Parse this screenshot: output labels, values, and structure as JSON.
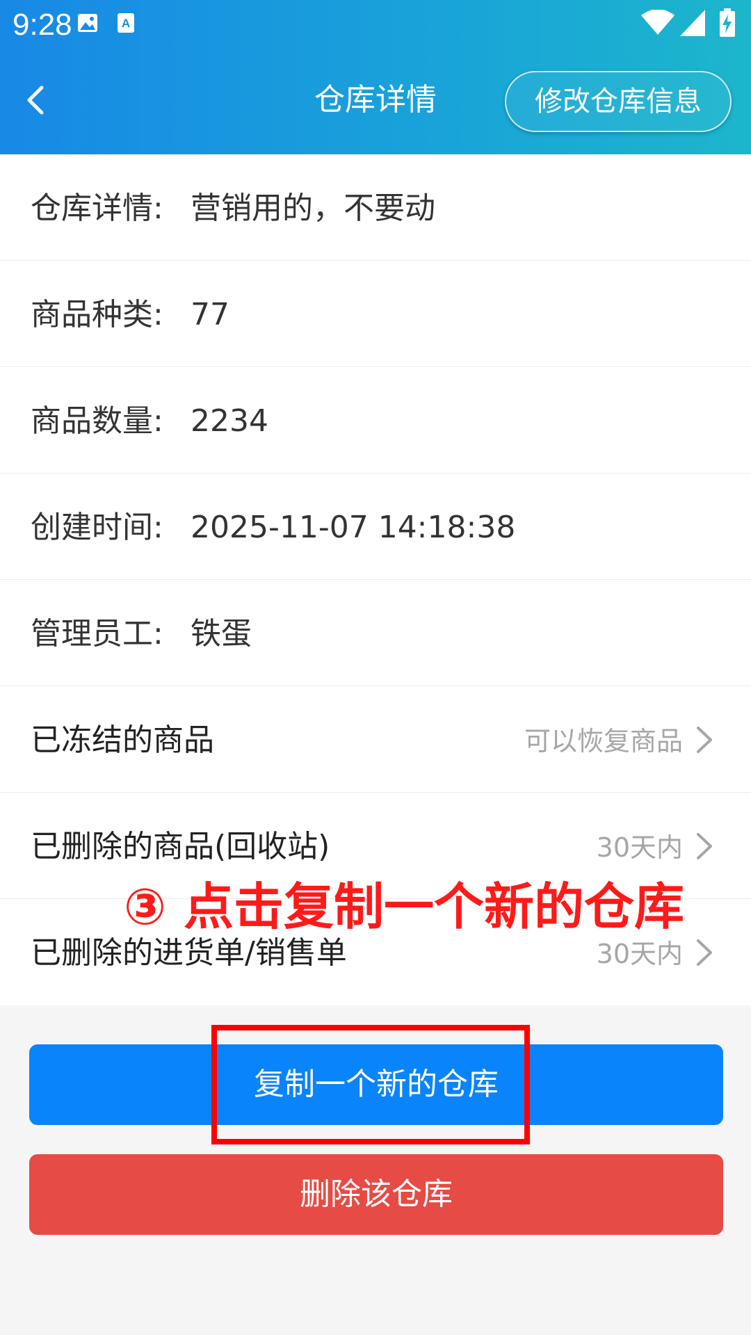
{
  "status_bar": {
    "time": "9:28"
  },
  "header": {
    "title": "仓库详情",
    "edit_button": "修改仓库信息"
  },
  "details": [
    {
      "label": "仓库详情:",
      "value": "营销用的，不要动"
    },
    {
      "label": "商品种类:",
      "value": "77"
    },
    {
      "label": "商品数量:",
      "value": "2234"
    },
    {
      "label": "创建时间:",
      "value": "2025-11-07 14:18:38"
    },
    {
      "label": "管理员工:",
      "value": "铁蛋"
    }
  ],
  "nav_rows": [
    {
      "label": "已冻结的商品",
      "hint": "可以恢复商品"
    },
    {
      "label": "已删除的商品(回收站)",
      "hint": "30天内"
    },
    {
      "label": "已删除的进货单/销售单",
      "hint": "30天内"
    }
  ],
  "annotation": "③ 点击复制一个新的仓库",
  "buttons": {
    "copy": "复制一个新的仓库",
    "delete": "删除该仓库"
  },
  "colors": {
    "primary": "#0a84fb",
    "danger": "#e64b45",
    "annotation": "#ff0000"
  }
}
